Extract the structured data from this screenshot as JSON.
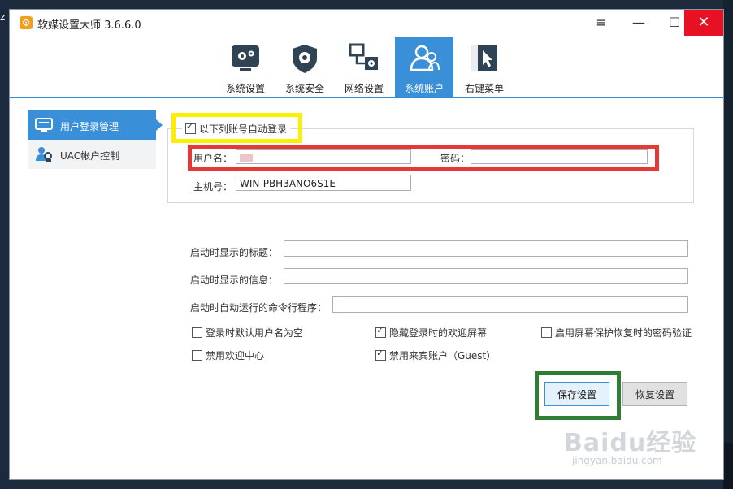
{
  "desktop": {
    "left_char": "z"
  },
  "window": {
    "app_icon_glyph": "⚙",
    "title": "软媒设置大师 3.6.6.0",
    "controls": {
      "menu": "≡",
      "minimize": "—",
      "maximize": "☐",
      "close": "✕"
    }
  },
  "toolbar": {
    "items": [
      {
        "label": "系统设置",
        "icon": "system-settings-icon",
        "active": false
      },
      {
        "label": "系统安全",
        "icon": "shield-gear-icon",
        "active": false
      },
      {
        "label": "网络设置",
        "icon": "network-icon",
        "active": false
      },
      {
        "label": "系统账户",
        "icon": "users-icon",
        "active": true
      },
      {
        "label": "右键菜单",
        "icon": "context-menu-icon",
        "active": false
      }
    ]
  },
  "sidebar": {
    "items": [
      {
        "label": "用户登录管理",
        "icon": "monitor-icon",
        "active": true
      },
      {
        "label": "UAC帐户控制",
        "icon": "uac-users-icon",
        "active": false
      }
    ]
  },
  "autologin": {
    "checkbox_label": "以下列账号自动登录",
    "checked": true,
    "username_label": "用户名：",
    "username_value": "",
    "password_label": "密码：",
    "password_value": "",
    "hostname_label": "主机号：",
    "hostname_value": "WIN-PBH3ANO6S1E"
  },
  "startup": {
    "title_label": "启动时显示的标题：",
    "title_value": "",
    "message_label": "启动时显示的信息：",
    "message_value": "",
    "command_label": "启动时自动运行的命令行程序：",
    "command_value": ""
  },
  "options": [
    {
      "label": "登录时默认用户名为空",
      "checked": false
    },
    {
      "label": "隐藏登录时的欢迎屏幕",
      "checked": true
    },
    {
      "label": "启用屏幕保护恢复时的密码验证",
      "checked": false
    },
    {
      "label": "禁用欢迎中心",
      "checked": false
    },
    {
      "label": "禁用来宾账户（Guest）",
      "checked": true
    }
  ],
  "buttons": {
    "save": "保存设置",
    "restore": "恢复设置"
  },
  "watermark": {
    "main": "Baidu经验",
    "sub": "jingyan.baidu.com"
  },
  "colors": {
    "accent": "#3a90d8",
    "close": "#e81123",
    "highlight_yellow": "#ffee00",
    "highlight_red": "#e53935",
    "highlight_green": "#2f7d32"
  }
}
